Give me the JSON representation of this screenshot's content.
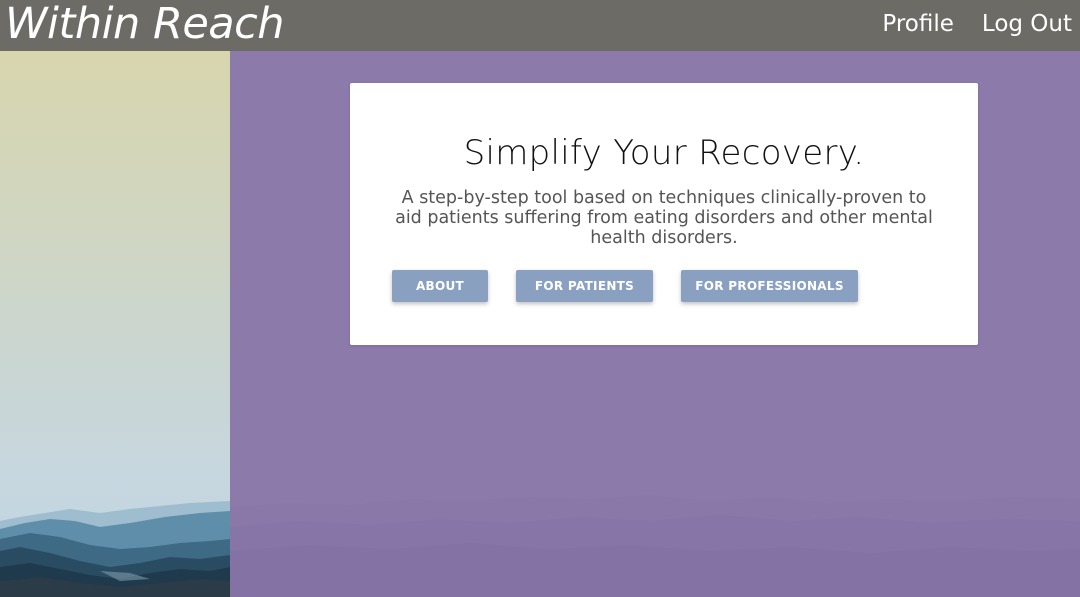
{
  "header": {
    "brand": "Within Reach",
    "nav": {
      "profile": "Profile",
      "logout": "Log Out"
    }
  },
  "hero": {
    "title": "Simplify Your Recovery.",
    "description": "A step-by-step tool based on techniques clinically-proven to aid patients suffering from eating disorders and other mental health disorders.",
    "buttons": {
      "about": "ABOUT",
      "patients": "FOR PATIENTS",
      "professionals": "FOR PROFESSIONALS"
    }
  },
  "colors": {
    "navbar": "#6c6b66",
    "purple": "#8c7aab",
    "button": "#8aa0c1",
    "card": "#ffffff"
  }
}
